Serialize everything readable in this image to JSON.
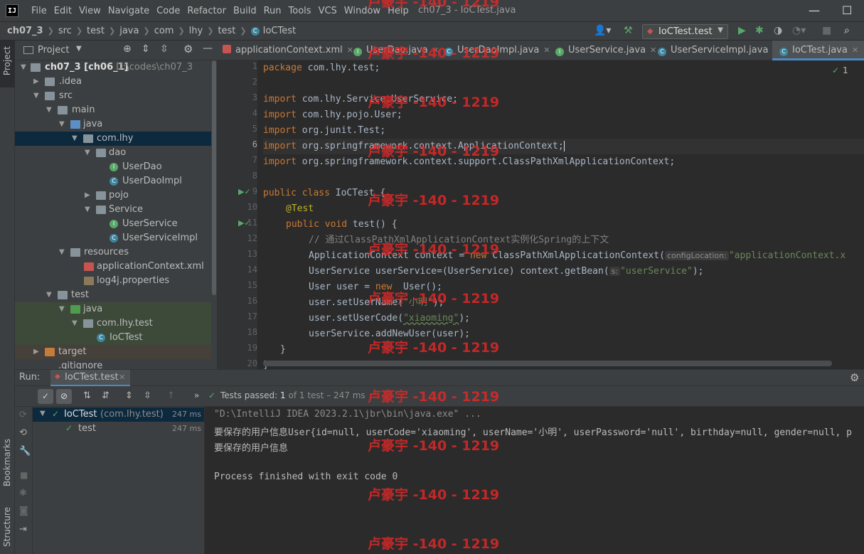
{
  "menubar": {
    "logo": "IJ",
    "items": [
      "File",
      "Edit",
      "View",
      "Navigate",
      "Code",
      "Refactor",
      "Build",
      "Run",
      "Tools",
      "VCS",
      "Window",
      "Help"
    ],
    "title": "ch07_3 - IoCTest.java"
  },
  "navbar": {
    "breadcrumbs": [
      "ch07_3",
      "src",
      "test",
      "java",
      "com",
      "lhy",
      "test",
      "IoCTest"
    ],
    "run_config": "IoCTest.test"
  },
  "project": {
    "header": "Project",
    "tree": [
      {
        "label": "ch07_3 [ch06_1]",
        "extra": "D:\\codes\\ch07_3"
      },
      {
        "label": ".idea"
      },
      {
        "label": "src"
      },
      {
        "label": "main"
      },
      {
        "label": "java"
      },
      {
        "label": "com.lhy"
      },
      {
        "label": "dao"
      },
      {
        "label": "UserDao"
      },
      {
        "label": "UserDaoImpl"
      },
      {
        "label": "pojo"
      },
      {
        "label": "Service"
      },
      {
        "label": "UserService"
      },
      {
        "label": "UserServiceImpl"
      },
      {
        "label": "resources"
      },
      {
        "label": "applicationContext.xml"
      },
      {
        "label": "log4j.properties"
      },
      {
        "label": "test"
      },
      {
        "label": "java"
      },
      {
        "label": "com.lhy.test"
      },
      {
        "label": "IoCTest"
      },
      {
        "label": "target"
      },
      {
        "label": ".gitignore"
      }
    ]
  },
  "tabs": [
    {
      "label": "applicationContext.xml"
    },
    {
      "label": "UserDao.java"
    },
    {
      "label": "UserDaoImpl.java"
    },
    {
      "label": "UserService.java"
    },
    {
      "label": "UserServiceImpl.java"
    },
    {
      "label": "IoCTest.java"
    }
  ],
  "editor": {
    "inspection_count": "1",
    "line_numbers": [
      "1",
      "2",
      "3",
      "4",
      "5",
      "6",
      "7",
      "8",
      "9",
      "10",
      "11",
      "12",
      "13",
      "14",
      "15",
      "16",
      "17",
      "18",
      "19",
      "20"
    ],
    "lines": {
      "l1a": "package ",
      "l1b": "com.lhy.test;",
      "l3a": "import ",
      "l3b": "com.lhy.Service.UserService;",
      "l4a": "import ",
      "l4b": "com.lhy.pojo.User;",
      "l5a": "import ",
      "l5b": "org.junit.Test;",
      "l6a": "import ",
      "l6b": "org.springframework.context.ApplicationContext;",
      "l7a": "import ",
      "l7b": "org.springframework.context.support.ClassPathXmlApplicationContext;",
      "l9a": "public class ",
      "l9b": "IoCTest {",
      "l10": "@Test",
      "l11a": "public void ",
      "l11b": "test() {",
      "l12": "// 通过ClassPathXmlApplicationContext实例化Spring的上下文",
      "l13a": "ApplicationContext context = ",
      "l13b": "new ",
      "l13c": "ClassPathXmlApplicationContext(",
      "l13h": "configLocation:",
      "l13s": "\"applicationContext.x",
      "l14a": "UserService userService=(UserService) context.getBean(",
      "l14h": "s:",
      "l14s": "\"userService\"",
      "l14e": ");",
      "l15a": "User user = ",
      "l15b": "new ",
      "l15c": " User();",
      "l16a": "user.setUserName(",
      "l16s": "\"小明\"",
      "l16e": ");",
      "l17a": "user.setUserCode(",
      "l17s": "\"xiaoming\"",
      "l17e": ");",
      "l18": "userService.addNewUser(user);",
      "l19": "}",
      "l20": "}"
    }
  },
  "run": {
    "label": "Run:",
    "tab": "IoCTest.test",
    "status": "Tests passed:",
    "status_count": "1",
    "status_rest": "of 1 test – 247 ms",
    "tree": [
      {
        "label": "IoCTest",
        "pkg": "(com.lhy.test)",
        "time": "247 ms"
      },
      {
        "label": "test",
        "pkg": "",
        "time": "247 ms"
      }
    ],
    "console": [
      "\"D:\\IntelliJ IDEA 2023.2.1\\jbr\\bin\\java.exe\" ...",
      "要保存的用户信息User{id=null, userCode='xiaoming', userName='小明', userPassword='null', birthday=null, gender=null, p",
      "要保存的用户信息",
      "",
      "Process finished with exit code 0"
    ]
  },
  "side": {
    "project": "Project",
    "bookmarks": "Bookmarks",
    "structure": "Structure"
  },
  "watermark": "卢豪宇 -140 - 1219"
}
